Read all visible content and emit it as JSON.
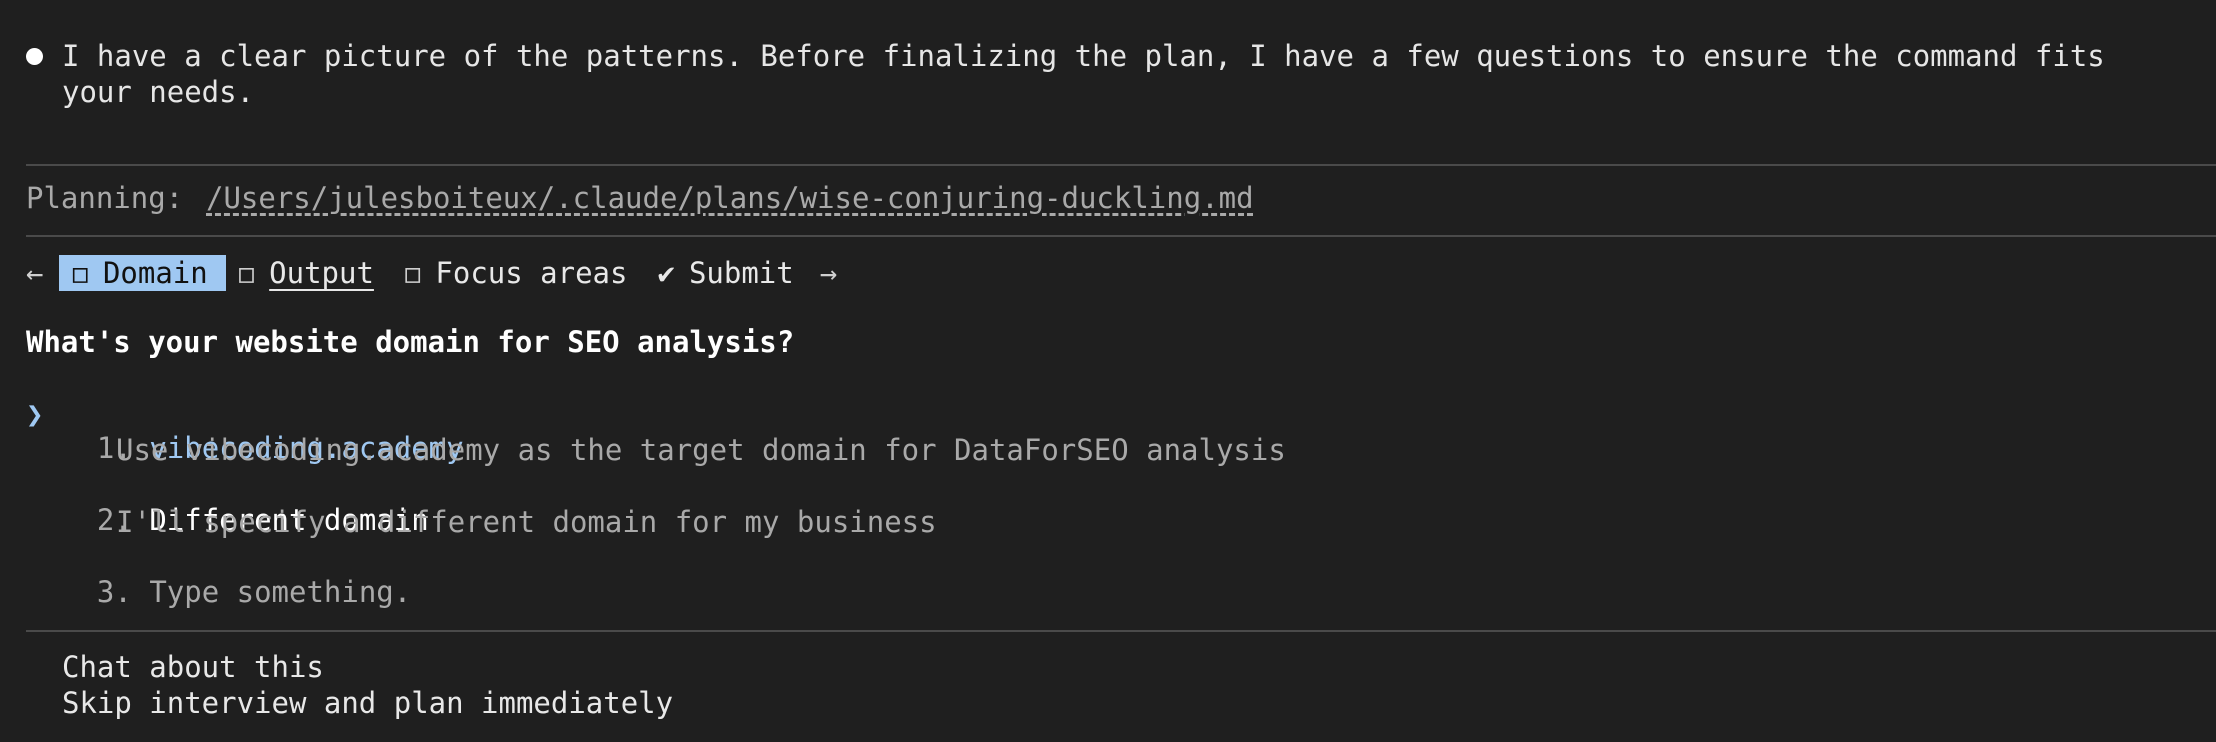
{
  "message": {
    "line1": "I have a clear picture of the patterns. Before finalizing the plan, I have a few questions to ensure the command fits",
    "line2": "your needs."
  },
  "planning": {
    "label": "Planning: ",
    "path": "/Users/julesboiteux/.claude/plans/wise-conjuring-duckling.md"
  },
  "tabs": {
    "prev_arrow": "←",
    "next_arrow": "→",
    "items": [
      {
        "box": "◻",
        "label": "Domain"
      },
      {
        "box": "◻",
        "label": "Output"
      },
      {
        "box": "◻",
        "label": "Focus areas"
      },
      {
        "box": "✔",
        "label": "Submit"
      }
    ]
  },
  "question": "What's your website domain for SEO analysis?",
  "options": {
    "pointer": "❯",
    "items": [
      {
        "num": "1.",
        "label": "vibecoding.academy",
        "desc": "Use vibecoding.academy as the target domain for DataForSEO analysis"
      },
      {
        "num": "2.",
        "label": "Different domain",
        "desc": "I'll specify a different domain for my business"
      },
      {
        "num": "3.",
        "label": "Type something."
      }
    ]
  },
  "footer": {
    "chat": "Chat about this",
    "skip": "Skip interview and plan immediately"
  },
  "colors": {
    "background": "#1f1f1f",
    "accent": "#9fc8f2",
    "muted": "#a9a9a9"
  }
}
